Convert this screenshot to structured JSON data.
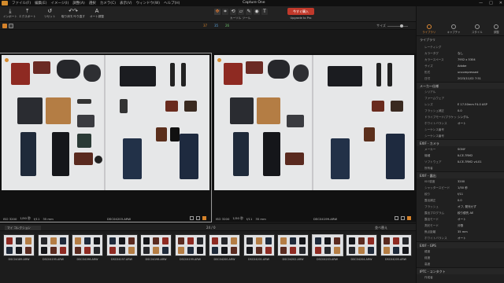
{
  "app": {
    "title": "Capture One"
  },
  "menu": [
    "ファイル(F)",
    "編集(E)",
    "イメージ(I)",
    "調整(A)",
    "選択",
    "カメラ(C)",
    "表示(V)",
    "ウィンドウ(W)",
    "ヘルプ(H)"
  ],
  "window_controls": [
    "—",
    "□",
    "✕"
  ],
  "toolbar": {
    "import": "インポート",
    "export": "エクスポート",
    "undo": "リセット",
    "redo": "取り消す/やり直す",
    "auto_adjust": "オート調整",
    "cursor_tools_label": "カーソル ツール",
    "upgrade_button": "今すぐ購入",
    "upgrade_label": "Upgrade to Pro",
    "right_tools": [
      "ヒント",
      "グリッド",
      "露出警告",
      "校正",
      "フォーカス",
      "コピー/適用"
    ]
  },
  "subbar": {
    "counts": [
      "37",
      "35",
      "26"
    ],
    "view_label": "サイズ"
  },
  "viewer": {
    "left": {
      "iso": "ISO 3200",
      "shutter": "1/50 秒",
      "aperture": "f/11",
      "focal": "35 mm",
      "filename": "DSC04203.ARW"
    },
    "right": {
      "iso": "ISO 3200",
      "shutter": "1/50 秒",
      "aperture": "f/11",
      "focal": "35 mm",
      "filename": "DSC04199.ARW"
    }
  },
  "filmstrip": {
    "collection": "マイ コレクション",
    "count": "24 / 0",
    "sort": "並べ替え",
    "thumbs": [
      "DSC04189.ARW",
      "DSC04195.ARW",
      "DSC04196.ARW",
      "DSC04197.ARW",
      "DSC04198.ARW",
      "DSC04199.ARW",
      "DSC04200.ARW",
      "DSC04201.ARW",
      "DSC04202.ARW",
      "DSC04203.ARW",
      "DSC04204.ARW",
      "DSC04205.ARW"
    ]
  },
  "right_panel": {
    "tabs": [
      "ライブラリ",
      "キャプチャ",
      "スタイル",
      "調整"
    ],
    "library_head": "ライブラリ",
    "sections": [
      {
        "title": "",
        "rows": [
          [
            "レーティング",
            ""
          ],
          [
            "カラータグ",
            "なし"
          ],
          [
            "カラースペース",
            "7952 x 5304"
          ],
          [
            "サイズ",
            "Adobe"
          ],
          [
            "形式",
            "uncompressed"
          ],
          [
            "日付",
            "2023/11/02 7:51"
          ]
        ]
      },
      {
        "title": "メーカー仕様",
        "rows": [
          [
            "シリアル",
            ""
          ],
          [
            "ファームウェア",
            ""
          ],
          [
            "レンズ",
            "E 17-50mm F4.0 ASP"
          ],
          [
            "フラッシュ補正",
            "0.0"
          ],
          [
            "ドライブモード/ブラケット",
            "シングル"
          ],
          [
            "ホワイトバランス",
            "オート"
          ],
          [
            "シーケンス番号",
            ""
          ],
          [
            "シーケンス番号",
            ""
          ]
        ]
      },
      {
        "title": "EXIF - カメラ",
        "rows": [
          [
            "メーカー",
            "SONY"
          ],
          [
            "機種",
            "ILCE-7RM2"
          ],
          [
            "ソフトウェア",
            "ILCE-7RM2 v4.01"
          ],
          [
            "所有者",
            ""
          ]
        ]
      },
      {
        "title": "EXIF - 露出",
        "rows": [
          [
            "ISO感度",
            "3200"
          ],
          [
            "シャッタースピード",
            "1/50 秒"
          ],
          [
            "絞り",
            "f/11"
          ],
          [
            "露出補正",
            "0.0"
          ],
          [
            "フラッシュ",
            "オフ, 発光せず"
          ],
          [
            "露出プログラム",
            "絞り優先 AE"
          ],
          [
            "露出モード",
            "オート"
          ],
          [
            "測光モード",
            "分割"
          ],
          [
            "焦点距離",
            "35 mm"
          ],
          [
            "ホワイトバランス",
            "オート"
          ]
        ]
      },
      {
        "title": "EXIF - GPS",
        "rows": [
          [
            "緯度",
            ""
          ],
          [
            "経度",
            ""
          ],
          [
            "高度",
            ""
          ]
        ]
      },
      {
        "title": "IPTC - コンタクト",
        "rows": [
          [
            "作成者",
            ""
          ]
        ]
      }
    ]
  }
}
